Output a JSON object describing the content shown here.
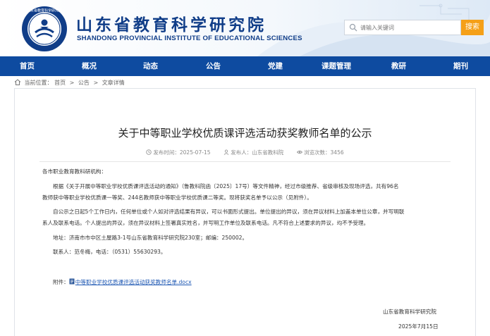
{
  "header": {
    "title": "山东省教育科学研究院",
    "subtitle": "SHANDONG PROVINCIAL INSTITUTE OF EDUCATIONAL SCIENCES",
    "logo_text": "山东省教育科学研究院",
    "search_placeholder": "请输入关键词",
    "search_button": "搜索"
  },
  "nav": {
    "items": [
      "首页",
      "概况",
      "动态",
      "公告",
      "党建",
      "课题管理",
      "教研",
      "期刊"
    ]
  },
  "breadcrumb": {
    "current_label": "当前位置：",
    "items": [
      "首页",
      "公告",
      "文章详情"
    ],
    "separator": ">"
  },
  "article": {
    "title": "关于中等职业学校优质课评选活动获奖教师名单的公示",
    "publish_label": "发布时间：",
    "publish_date": "2025-07-15",
    "publisher_label": "发布人：",
    "publisher": "山东省教科院",
    "views_label": "浏览次数：",
    "views": "3456",
    "salutation": "各市职业教育教科研机构：",
    "para1": [
      "根据《关于开展中等职业学校优质课评选活动的通知》（鲁教科院函〔2025〕17号）等文件精神，经过市级推荐、省级审核及现场评选，共有96名",
      "教师获中等职业学校优质课一等奖、244名教师获中等职业学校优质课二等奖。现将获奖名单予以公示（见附件）。"
    ],
    "para2": [
      "自公示之日起5个工作日内，任何单位或个人如对评选结果有异议，可以书面形式提出。单位提出的异议，须在异议材料上加盖本单位公章，并写明联",
      "系人及联系电话。个人提出的异议，须在异议材料上签署真实姓名，并写明工作单位及联系电话。凡不符合上述要求的异议，均不予受理。"
    ],
    "address": "地址：济南市市中区土屋路3-1号山东省教育科学研究院230室；邮编：250002。",
    "contact": "联系人：范冬梅，电话：（0531）55630293。",
    "attachment_label": "附件：",
    "attachment_name": "中等职业学校优质课评选活动获奖教师名单.docx",
    "sign_org": "山东省教育科学研究院",
    "sign_date": "2025年7月15日"
  },
  "colors": {
    "brand_blue": "#103d88",
    "nav_blue": "#0e4ba0",
    "search_orange": "#f5a018",
    "link_blue": "#1d57b3"
  },
  "icons": [
    "logo-emblem",
    "search-icon",
    "home-icon",
    "clock-icon",
    "user-icon",
    "eye-icon",
    "doc-icon"
  ]
}
